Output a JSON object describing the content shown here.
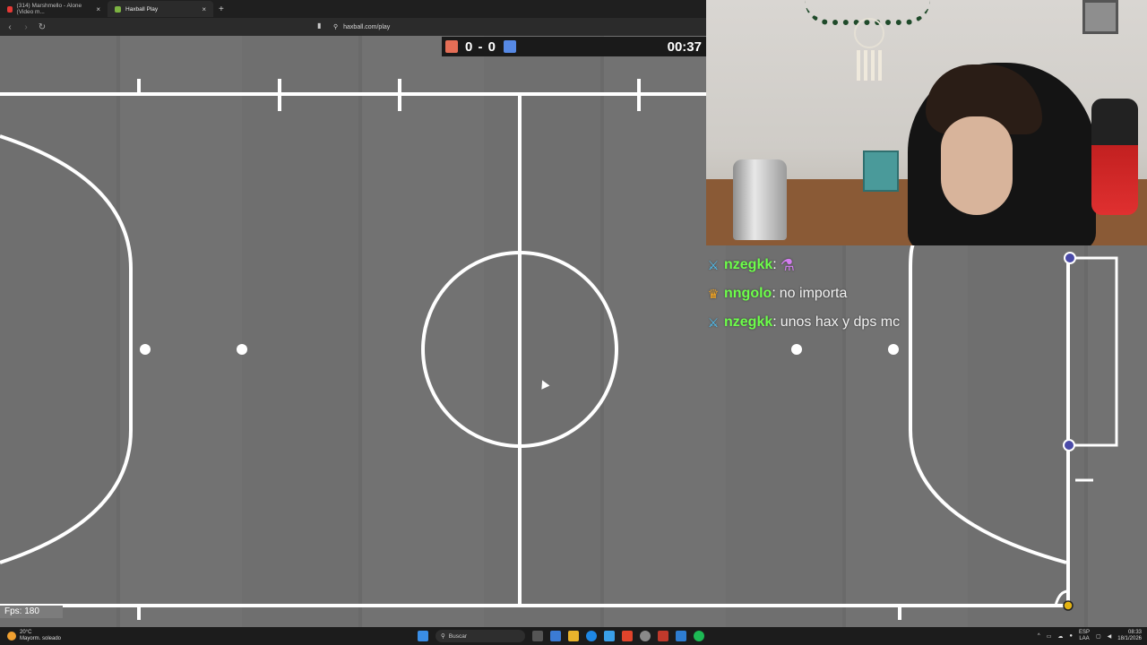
{
  "browser": {
    "tabs": [
      {
        "label": "(314) Marshmello - Alone (Video m...",
        "active": false,
        "favicon_color": "#e53935"
      },
      {
        "label": "Haxball Play",
        "active": true,
        "favicon_color": "#7cb342"
      }
    ],
    "new_tab_symbol": "+",
    "url": "haxball.com/play"
  },
  "game": {
    "score": "0 - 0",
    "timer": "00:37",
    "red_color": "#e56e56",
    "blue_color": "#5689e5",
    "fps_label": "Fps: 180"
  },
  "chat": {
    "messages": [
      {
        "badge": "sword-icon",
        "user": "nzegkk",
        "sep": ":",
        "text": "",
        "emote": "⚗"
      },
      {
        "badge": "crown-icon",
        "user": "nngolo",
        "sep": ":",
        "text": "no importa"
      },
      {
        "badge": "sword-icon",
        "user": "nzegkk",
        "sep": ":",
        "text": "unos hax y dps mc"
      }
    ],
    "username_color": "#6dff4a"
  },
  "taskbar": {
    "weather_temp": "20°C",
    "weather_desc": "Mayorm. soleado",
    "search_placeholder": "Buscar",
    "lang_top": "ESP",
    "lang_bottom": "LAA",
    "time": "08:33",
    "date": "18/1/2026"
  }
}
